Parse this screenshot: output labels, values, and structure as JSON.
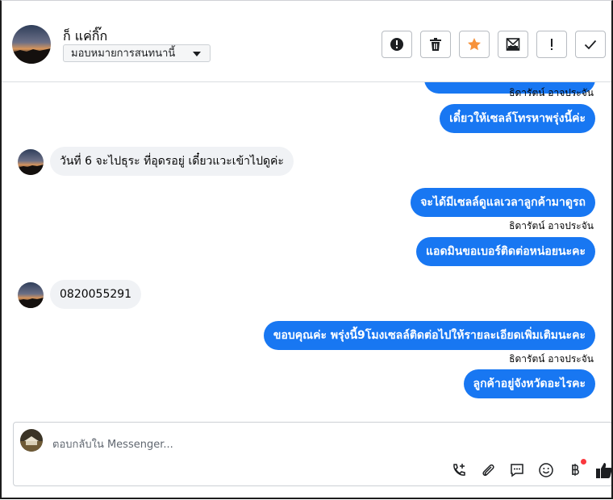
{
  "header": {
    "contact_name": "ก็ แค่กิ๊ก",
    "assign_label": "มอบหมายการสนทนานี้",
    "buttons": [
      {
        "name": "mark-spam-button",
        "icon": "alert-circle-icon"
      },
      {
        "name": "delete-button",
        "icon": "trash-icon"
      },
      {
        "name": "star-button",
        "icon": "star-icon",
        "color": "#f7923b"
      },
      {
        "name": "mark-unread-button",
        "icon": "envelope-icon"
      },
      {
        "name": "follow-up-button",
        "icon": "exclamation-icon"
      },
      {
        "name": "mark-done-button",
        "icon": "check-icon"
      }
    ]
  },
  "messages": [
    {
      "direction": "out",
      "text": "",
      "partial": true
    },
    {
      "direction": "sender",
      "text": "ธิดารัตน์ อาจประจัน"
    },
    {
      "direction": "out",
      "text": "เดี๋ยวให้เซลล์โทรหาพรุ่งนี้ค่ะ"
    },
    {
      "direction": "in",
      "text": "วันที่ 6 จะไปธุระ ที่อุดรอยู่ เดี๋ยวแวะเข้าไปดูค่ะ"
    },
    {
      "direction": "out",
      "text": "จะได้มีเซลล์ดูแลเวลาลูกค้ามาดูรถ"
    },
    {
      "direction": "sender",
      "text": "ธิดารัตน์ อาจประจัน"
    },
    {
      "direction": "out",
      "text": "แอดมินขอเบอร์ติดต่อหน่อยนะคะ"
    },
    {
      "direction": "in",
      "text": "0820055291"
    },
    {
      "direction": "out",
      "text": "ขอบคุณค่ะ พรุ่งนี้9โมงเซลล์ติดต่อไปให้รายละเอียดเพิ่มเติมนะคะ"
    },
    {
      "direction": "sender",
      "text": "ธิดารัตน์ อาจประจัน"
    },
    {
      "direction": "out",
      "text": "ลูกค้าอยู่จังหวัดอะไรคะ"
    }
  ],
  "composer": {
    "placeholder": "ตอบกลับใน Messenger...",
    "icons": [
      "add-call-icon",
      "attachment-icon",
      "saved-reply-icon",
      "emoji-icon",
      "baht-payment-icon",
      "thumbs-up-icon"
    ]
  },
  "colors": {
    "outgoing_bubble": "#1877f2",
    "incoming_bubble": "#f0f2f5",
    "star": "#f7923b",
    "notification_dot": "#fa383e"
  }
}
